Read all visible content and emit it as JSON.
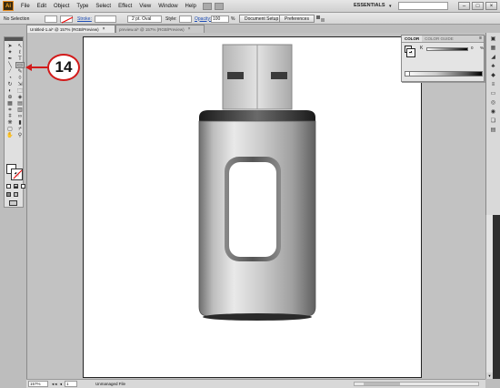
{
  "app": {
    "logo": "Ai",
    "menus": [
      "File",
      "Edit",
      "Object",
      "Type",
      "Select",
      "Effect",
      "View",
      "Window",
      "Help"
    ],
    "workspace": "ESSENTIALS"
  },
  "control_bar": {
    "selection": "No Selection",
    "stroke_label": "Stroke:",
    "stroke_weight": "2 pt. Oval",
    "style_label": "Style:",
    "opacity_label": "Opacity:",
    "opacity_value": "100",
    "opacity_unit": "%",
    "document_setup": "Document Setup",
    "preferences": "Preferences"
  },
  "tabs": [
    {
      "label": "Untitled-1.ai* @ 157% (RGB/Preview)",
      "close": "×"
    },
    {
      "label": "preview.ai* @ 157% (RGB/Preview)",
      "close": "×"
    }
  ],
  "callout": {
    "number": "14"
  },
  "color_panel": {
    "tab_color": "COLOR",
    "tab_guide": "COLOR GUIDE",
    "channel": "K",
    "value": "0",
    "unit": "%"
  },
  "status_bar": {
    "zoom": "157%",
    "nav": "◂◂ ◂",
    "page": "1",
    "status": "Unmanaged File"
  },
  "colors": {
    "callout_red": "#d21a1a",
    "ui_gray": "#bdbdbd",
    "artboard": "#ffffff"
  }
}
